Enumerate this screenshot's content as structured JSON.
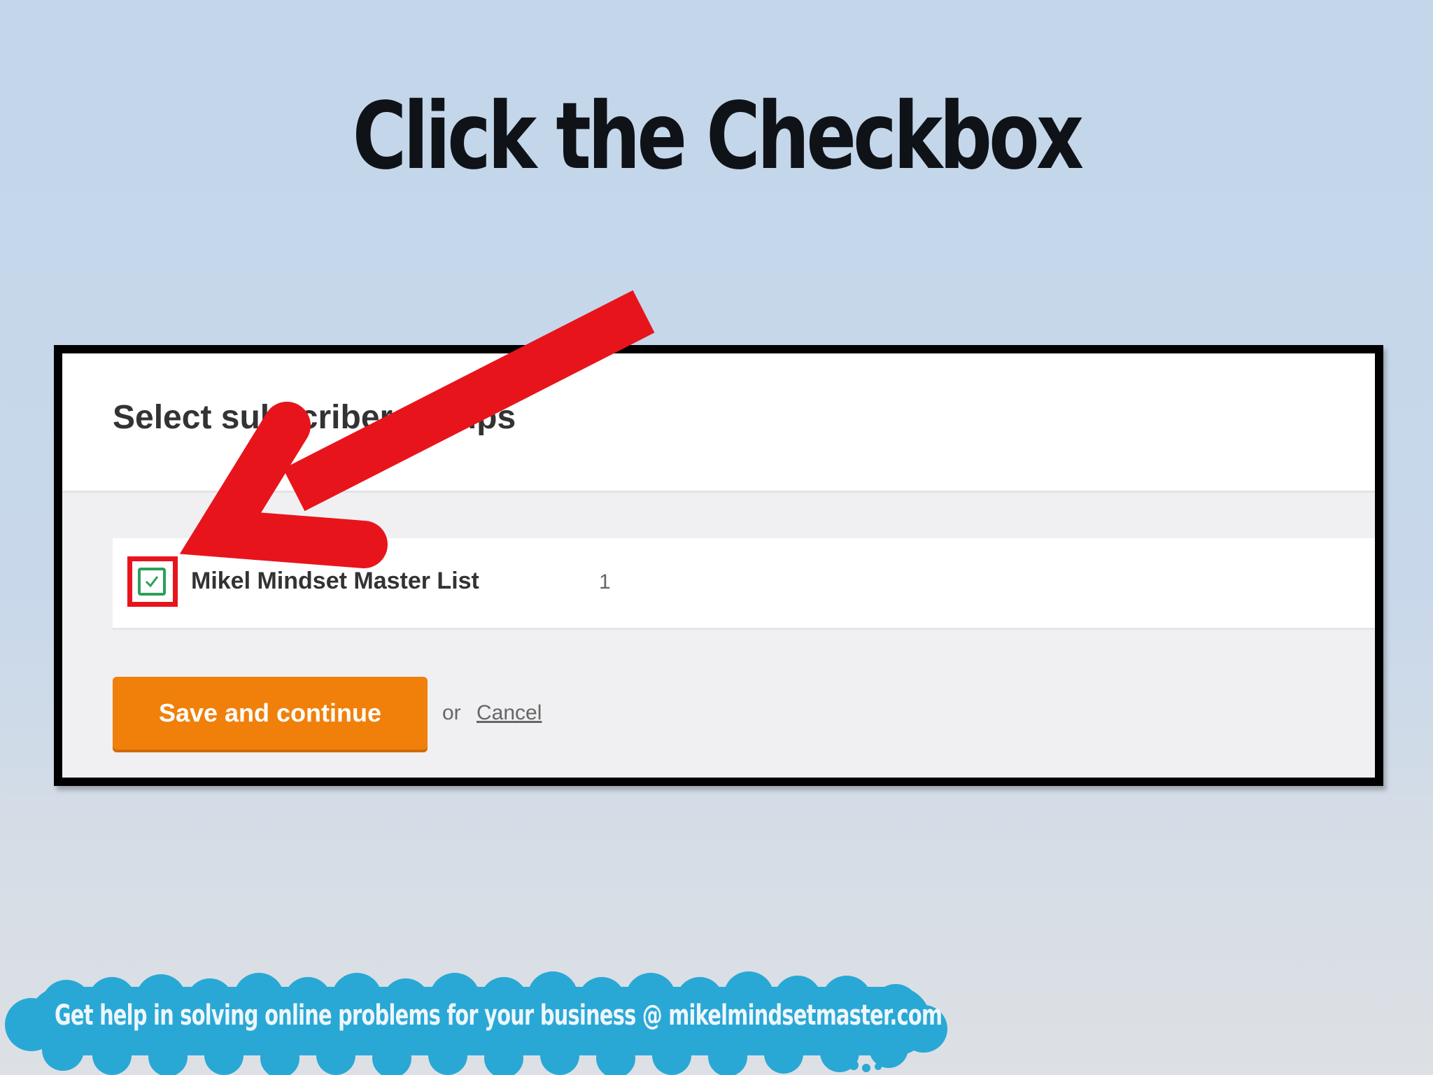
{
  "slide": {
    "title": "Click the Checkbox"
  },
  "modal": {
    "title": "Select subscriber groups",
    "group": {
      "name": "Mikel Mindset Master List",
      "count": "1",
      "checked": true
    },
    "save_label": "Save and continue",
    "or_text": "or",
    "cancel_label": "Cancel"
  },
  "annotation": {
    "arrow_color": "#e8141c",
    "highlight_color": "#e8141c",
    "arrow_icon": "arrow-pointing-down-left"
  },
  "footer": {
    "text": "Get help in solving online problems for your business @ mikelmindsetmaster.com",
    "cloud_color": "#29a8d6"
  },
  "colors": {
    "accent_button": "#f0800a",
    "checkbox": "#2ca05a"
  }
}
